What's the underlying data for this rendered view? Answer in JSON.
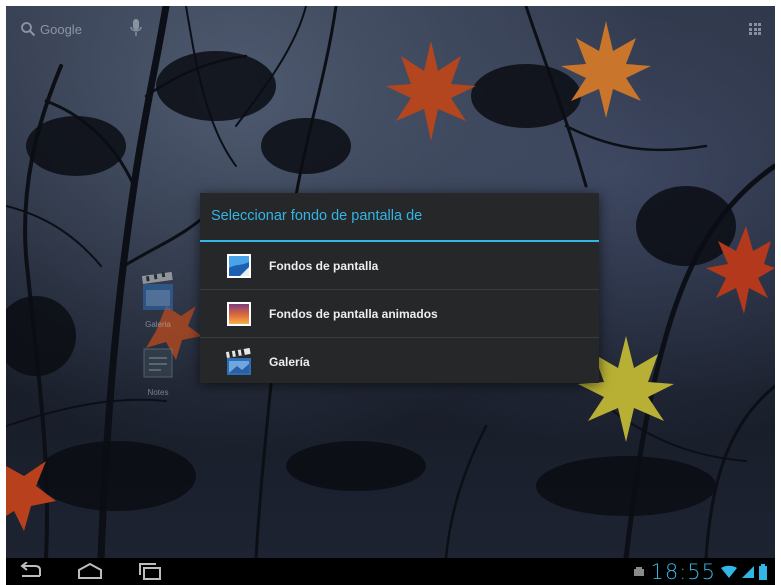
{
  "launcher": {
    "search_label": "Google",
    "search_icon": "search-icon",
    "voice_icon": "microphone-icon",
    "apps_icon": "all-apps-icon"
  },
  "shortcuts": [
    {
      "label": "Galeria",
      "icon": "gallery-icon"
    },
    {
      "label": "Notes",
      "icon": "notes-icon"
    }
  ],
  "dialog": {
    "title": "Seleccionar fondo de pantalla de",
    "options": [
      {
        "label": "Fondos de pantalla",
        "icon": "wallpaper-icon"
      },
      {
        "label": "Fondos de pantalla animados",
        "icon": "live-wallpaper-icon"
      },
      {
        "label": "Galería",
        "icon": "gallery-icon"
      }
    ]
  },
  "navbar": {
    "back_icon": "back-icon",
    "home_icon": "home-icon",
    "recent_icon": "recent-apps-icon"
  },
  "status": {
    "time": "18:55",
    "notification_icon": "notification-icon",
    "wifi_icon": "wifi-icon",
    "signal_icon": "signal-icon",
    "battery_icon": "battery-icon"
  },
  "colors": {
    "accent": "#33b5e5",
    "dialog_bg": "#262729",
    "navbar_bg": "#000000"
  }
}
